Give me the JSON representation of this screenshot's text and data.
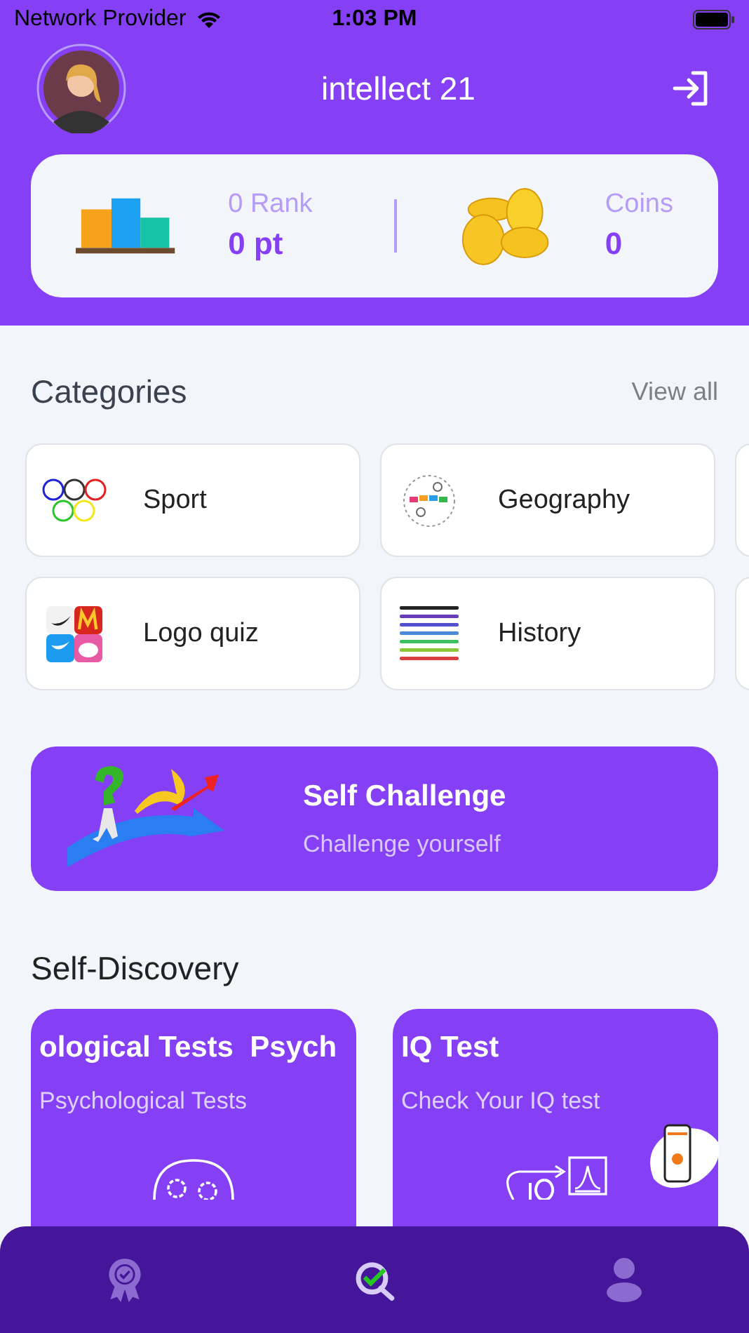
{
  "status_bar": {
    "carrier": "Network Provider",
    "time": "1:03 PM"
  },
  "header": {
    "username": "intellect 21"
  },
  "stats": {
    "rank_label": "0 Rank",
    "points": "0 pt",
    "coins_label": "Coins",
    "coins": "0"
  },
  "categories": {
    "title": "Categories",
    "view_all": "View all",
    "items": [
      {
        "name": "Sport",
        "kind": "sport"
      },
      {
        "name": "Geography",
        "kind": "geography"
      },
      {
        "name": "Logo quiz",
        "kind": "logos"
      },
      {
        "name": "History",
        "kind": "history"
      }
    ]
  },
  "challenge": {
    "title": "Self Challenge",
    "subtitle": "Challenge yourself"
  },
  "discovery": {
    "title": "Self-Discovery",
    "cards": [
      {
        "title": "ological Tests  Psych",
        "subtitle": "Psychological Tests",
        "kind": "psych"
      },
      {
        "title": "IQ Test",
        "subtitle": "Check Your IQ test",
        "kind": "iq"
      }
    ]
  },
  "tab_bar": [
    {
      "kind": "badge",
      "selected": false
    },
    {
      "kind": "quiz",
      "selected": true
    },
    {
      "kind": "profile",
      "selected": false
    }
  ]
}
